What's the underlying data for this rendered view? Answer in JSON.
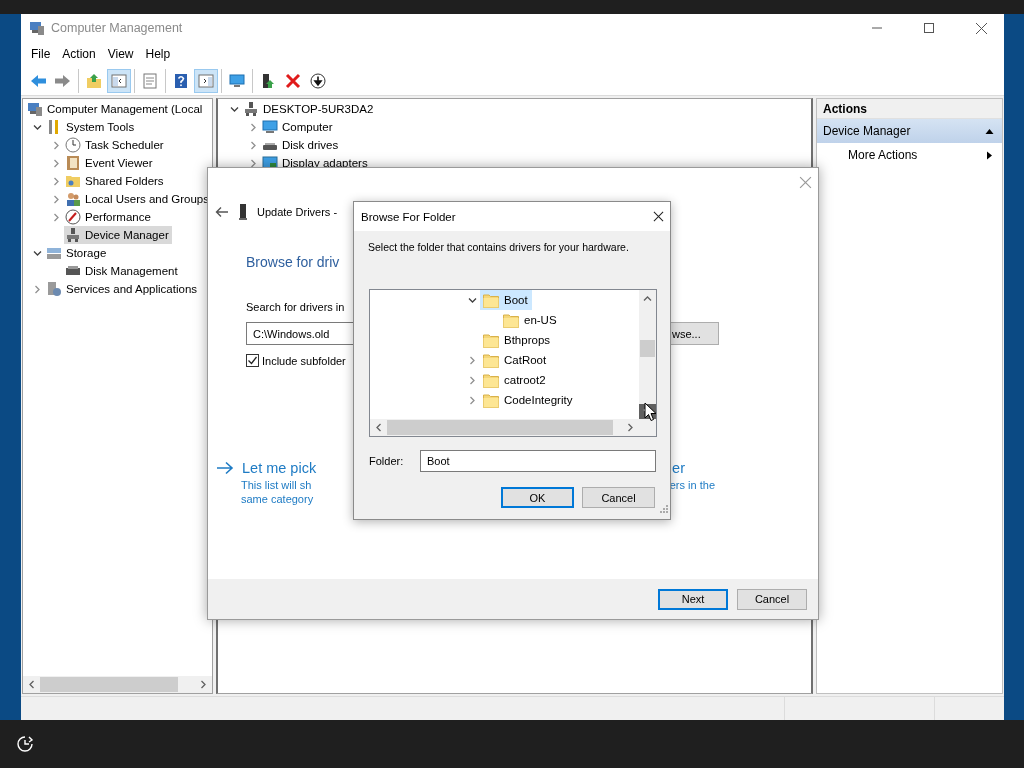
{
  "window": {
    "title": "Computer Management"
  },
  "menu": [
    "File",
    "Action",
    "View",
    "Help"
  ],
  "toolbar": [
    {
      "buttons": [
        {
          "kind": "back",
          "pressed": false
        },
        {
          "kind": "forward",
          "pressed": false
        }
      ]
    },
    {
      "buttons": [
        {
          "kind": "up",
          "pressed": false
        },
        {
          "kind": "tree",
          "pressed": true
        }
      ]
    },
    {
      "buttons": [
        {
          "kind": "properties",
          "pressed": false
        }
      ]
    },
    {
      "buttons": [
        {
          "kind": "help",
          "pressed": false
        },
        {
          "kind": "pane",
          "pressed": true
        }
      ]
    },
    {
      "buttons": [
        {
          "kind": "monitor",
          "pressed": false
        }
      ]
    },
    {
      "buttons": [
        {
          "kind": "update",
          "pressed": false
        },
        {
          "kind": "remove",
          "pressed": false
        },
        {
          "kind": "download",
          "pressed": false
        }
      ]
    }
  ],
  "nav_tree": [
    {
      "label": "Computer Management (Local",
      "selected": false,
      "children": [
        {
          "label": "System Tools",
          "expanded": true,
          "selected": false,
          "children": [
            {
              "label": "Task Scheduler",
              "expanded": false,
              "selected": false
            },
            {
              "label": "Event Viewer",
              "expanded": false,
              "selected": false
            },
            {
              "label": "Shared Folders",
              "expanded": false,
              "selected": false
            },
            {
              "label": "Local Users and Groups",
              "expanded": false,
              "selected": false
            },
            {
              "label": "Performance",
              "expanded": false,
              "selected": false
            },
            {
              "label": "Device Manager",
              "selected": true
            }
          ]
        },
        {
          "label": "Storage",
          "expanded": true,
          "selected": false,
          "children": [
            {
              "label": "Disk Management",
              "selected": false
            }
          ]
        },
        {
          "label": "Services and Applications",
          "expanded": false,
          "selected": false
        }
      ]
    }
  ],
  "devices": [
    {
      "label": "DESKTOP-5UR3DA2",
      "expanded": true,
      "children": [
        {
          "label": "Computer",
          "expanded": false
        },
        {
          "label": "Disk drives",
          "expanded": false
        },
        {
          "label": "Display adapters",
          "expanded": false
        }
      ]
    }
  ],
  "actions": {
    "title": "Actions",
    "sections": [
      {
        "label": "Device Manager",
        "expanded": true,
        "items": [
          {
            "label": "More Actions"
          }
        ]
      }
    ]
  },
  "wizard": {
    "title": "Update Drivers -",
    "heading": "Browse for driv",
    "search_label": "Search for drivers in",
    "path": "C:\\Windows.old",
    "browse_button": "wse...",
    "include_subfolders": {
      "label": "Include subfolder",
      "checked": true
    },
    "pick_link": {
      "title": "Let me pick",
      "title_tail": "er",
      "line_1": "This list will sh",
      "line_1_tail": "ers in the",
      "line_2": "same category"
    },
    "buttons": [
      {
        "label": "Next",
        "default": true
      },
      {
        "label": "Cancel",
        "default": false
      }
    ]
  },
  "browse_dialog": {
    "title": "Browse For Folder",
    "prompt": "Select the folder that contains drivers for your hardware.",
    "folders": [
      {
        "label": "Boot",
        "expanded": true,
        "selected": true,
        "children": [
          {
            "label": "en-US",
            "selected": false
          }
        ]
      },
      {
        "label": "Bthprops",
        "selected": false
      },
      {
        "label": "CatRoot",
        "expanded": false,
        "selected": false
      },
      {
        "label": "catroot2",
        "expanded": false,
        "selected": false
      },
      {
        "label": "CodeIntegrity",
        "expanded": false,
        "selected": false
      }
    ],
    "folder_label": "Folder:",
    "folder_value": "Boot",
    "buttons": [
      {
        "label": "OK",
        "default": true
      },
      {
        "label": "Cancel",
        "default": false
      }
    ]
  }
}
